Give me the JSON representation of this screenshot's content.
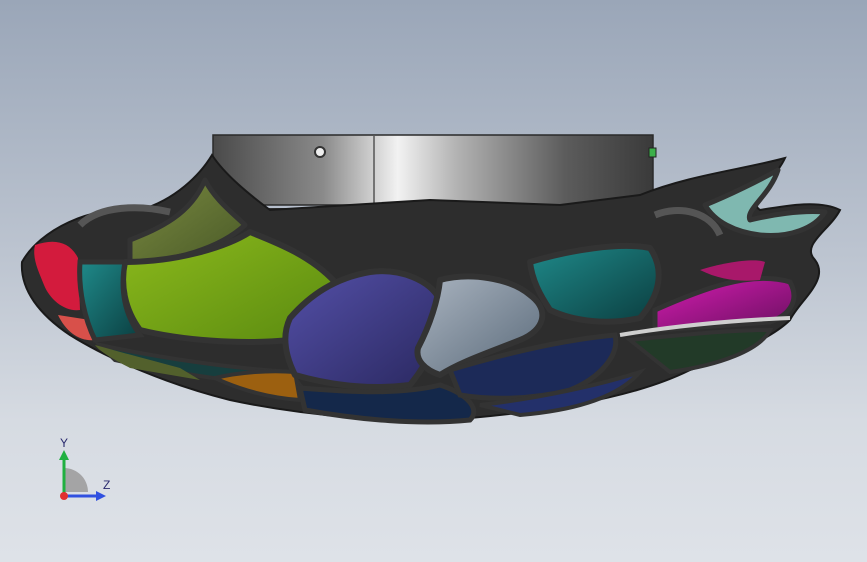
{
  "view": {
    "background_top": "#9aa6b8",
    "background_bottom": "#dee2e8"
  },
  "model": {
    "name": "stained-glass-ceiling-lamp",
    "canopy_color": "#b8b8b8",
    "frame_color": "#3a3a3a",
    "glass_colors": [
      "#d21a3a",
      "#0f5a58",
      "#6a9a14",
      "#3f3c8a",
      "#7e8ea0",
      "#1a2a5a",
      "#b06a12",
      "#c01c9a",
      "#88c0c0",
      "#1f6e76"
    ]
  },
  "triad": {
    "y_label": "Y",
    "z_label": "Z",
    "x_color": "#e03030",
    "y_color": "#20b040",
    "z_color": "#3050e0"
  }
}
